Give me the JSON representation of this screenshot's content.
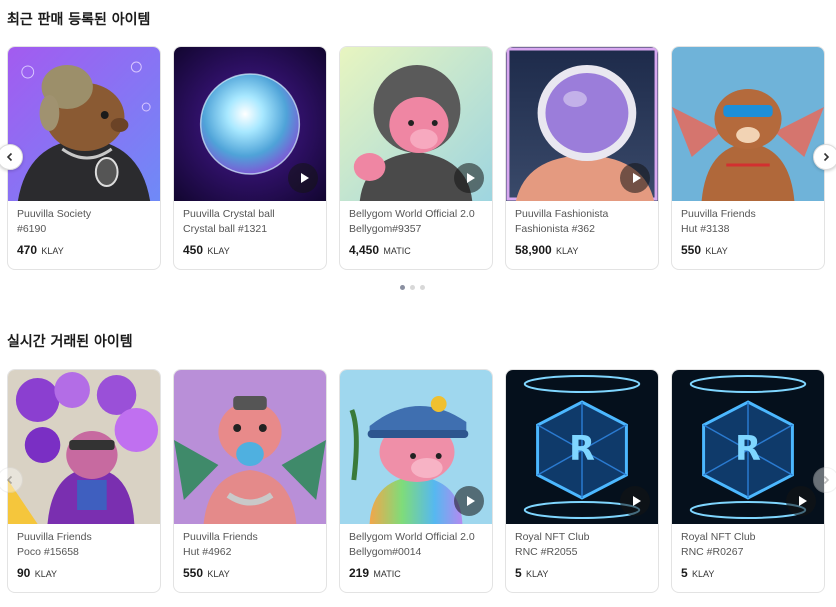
{
  "recent_section": {
    "title": "최근 판매 등록된 아이템",
    "items": [
      {
        "collection": "Puuvilla Society",
        "token": "#6190",
        "price": "470",
        "currency": "KLAY",
        "image": "capybara-wig-avatar"
      },
      {
        "collection": "Puuvilla Crystal ball",
        "token": "Crystal ball #1321",
        "price": "450",
        "currency": "KLAY",
        "image": "crystal-ball"
      },
      {
        "collection": "Bellygom World Official 2.0",
        "token": "Bellygom#9357",
        "price": "4,450",
        "currency": "MATIC",
        "image": "bear-knight-helmet"
      },
      {
        "collection": "Puuvilla Fashionista",
        "token": "Fashionista #362",
        "price": "58,900",
        "currency": "KLAY",
        "image": "astronaut-helmet"
      },
      {
        "collection": "Puuvilla Friends",
        "token": "Hut #3138",
        "price": "550",
        "currency": "KLAY",
        "image": "raccoon-wings"
      }
    ],
    "pagination": {
      "count": 3,
      "active": 0
    }
  },
  "live_section": {
    "title": "실시간 거래된 아이템",
    "items": [
      {
        "collection": "Puuvilla Friends",
        "token": "Poco #15658",
        "price": "90",
        "currency": "KLAY",
        "image": "balloon-character"
      },
      {
        "collection": "Puuvilla Friends",
        "token": "Hut #4962",
        "price": "550",
        "currency": "KLAY",
        "image": "raccoon-bubblegum"
      },
      {
        "collection": "Bellygom World Official 2.0",
        "token": "Bellygom#0014",
        "price": "219",
        "currency": "MATIC",
        "image": "bear-police-cap"
      },
      {
        "collection": "Royal NFT Club",
        "token": "RNC #R2055",
        "price": "5",
        "currency": "KLAY",
        "image": "neon-cube"
      },
      {
        "collection": "Royal NFT Club",
        "token": "RNC #R0267",
        "price": "5",
        "currency": "KLAY",
        "image": "neon-cube"
      }
    ]
  },
  "icons": {
    "prev": "chevron-left-icon",
    "next": "chevron-right-icon",
    "play": "play-icon"
  },
  "colors": {
    "card_border": "#e3e3e3",
    "pagination_active": "#8a8fa0",
    "pagination_inactive": "#d8d8d8"
  }
}
